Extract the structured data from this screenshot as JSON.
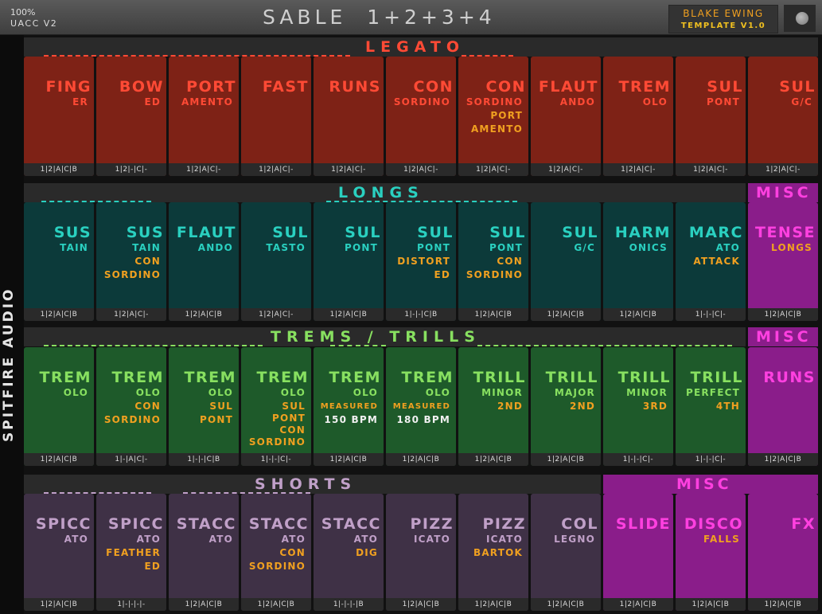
{
  "header": {
    "zoom": "100%",
    "version": "UACC V2",
    "title": "SABLE  1+2+3+4",
    "author": "BLAKE EWING",
    "template": "TEMPLATE V1.0"
  },
  "sidebar": {
    "label": "SPITFIRE AUDIO"
  },
  "colors": {
    "legato_tile": "#7e2216",
    "legato_text": "#ff4a35",
    "longs_tile": "#0c3a3a",
    "longs_text": "#2ad0c0",
    "trems_tile": "#1e5a2a",
    "trems_text": "#88e060",
    "shorts_tile": "#3f3146",
    "shorts_text": "#c0a0c8",
    "misc_tile": "#8a1d8a",
    "misc_text": "#ff40e0",
    "orange": "#f0a020"
  },
  "sections": {
    "legato": {
      "label": "LEGATO"
    },
    "longs": {
      "label": "LONGS",
      "misc": "MISC"
    },
    "trems": {
      "label": "TREMS / TRILLS",
      "misc": "MISC"
    },
    "shorts": {
      "label": "SHORTS",
      "misc": "MISC"
    }
  },
  "legato": [
    {
      "t1": "FING",
      "t2": "ER",
      "foot": "1|2|A|C|B"
    },
    {
      "t1": "BOW",
      "t2": "ED",
      "foot": "1|2|-|C|-"
    },
    {
      "t1": "PORT",
      "t2": "AMENTO",
      "foot": "1|2|A|C|-"
    },
    {
      "t1": "FAST",
      "t2": "",
      "foot": "1|2|A|C|-"
    },
    {
      "t1": "RUNS",
      "t2": "",
      "foot": "1|2|A|C|-"
    },
    {
      "t1": "CON",
      "t2": "SORDINO",
      "foot": "1|2|A|C|-"
    },
    {
      "t1": "CON",
      "t2": "SORDINO",
      "o1": "PORT",
      "o2": "AMENTO",
      "foot": "1|2|A|C|-"
    },
    {
      "t1": "FLAUT",
      "t2": "ANDO",
      "foot": "1|2|A|C|-"
    },
    {
      "t1": "TREM",
      "t2": "OLO",
      "foot": "1|2|A|C|-"
    },
    {
      "t1": "SUL",
      "t2": "PONT",
      "foot": "1|2|A|C|-"
    },
    {
      "t1": "SUL",
      "t2": "G/C",
      "foot": "1|2|A|C|-"
    }
  ],
  "longs": [
    {
      "t1": "SUS",
      "t2": "TAIN",
      "foot": "1|2|A|C|B"
    },
    {
      "t1": "SUS",
      "t2": "TAIN",
      "o1": "CON",
      "o2": "SORDINO",
      "foot": "1|2|A|C|-"
    },
    {
      "t1": "FLAUT",
      "t2": "ANDO",
      "foot": "1|2|A|C|B"
    },
    {
      "t1": "SUL",
      "t2": "TASTO",
      "foot": "1|2|A|C|-"
    },
    {
      "t1": "SUL",
      "t2": "PONT",
      "foot": "1|2|A|C|B"
    },
    {
      "t1": "SUL",
      "t2": "PONT",
      "o1": "DISTORT",
      "o2": "ED",
      "foot": "1|-|-|C|B"
    },
    {
      "t1": "SUL",
      "t2": "PONT",
      "o1": "CON",
      "o2": "SORDINO",
      "foot": "1|2|A|C|B"
    },
    {
      "t1": "SUL",
      "t2": "G/C",
      "foot": "1|2|A|C|B"
    },
    {
      "t1": "HARM",
      "t2": "ONICS",
      "foot": "1|2|A|C|B"
    },
    {
      "t1": "MARC",
      "t2": "ATO",
      "o1": "ATTACK",
      "foot": "1|-|-|C|-"
    },
    {
      "t1": "TENSE",
      "t2": "LONGS",
      "foot": "1|2|A|C|B"
    }
  ],
  "trems": [
    {
      "t1": "TREM",
      "t2": "OLO",
      "foot": "1|2|A|C|B"
    },
    {
      "t1": "TREM",
      "t2": "OLO",
      "o1": "CON",
      "o2": "SORDINO",
      "foot": "1|-|A|C|-"
    },
    {
      "t1": "TREM",
      "t2": "OLO",
      "o1": "SUL",
      "o2": "PONT",
      "foot": "1|-|-|C|B"
    },
    {
      "t1": "TREM",
      "t2": "OLO",
      "o1": "SUL",
      "o2": "PONT",
      "o3": "CON",
      "o4": "SORDINO",
      "foot": "1|-|-|C|-"
    },
    {
      "t1": "TREM",
      "t2": "OLO",
      "o1": "MEASURED",
      "o2": "150 BPM",
      "foot": "1|2|A|C|B"
    },
    {
      "t1": "TREM",
      "t2": "OLO",
      "o1": "MEASURED",
      "o2": "180 BPM",
      "foot": "1|2|A|C|B"
    },
    {
      "t1": "TRILL",
      "t2": "MINOR",
      "o1": "2ND",
      "foot": "1|2|A|C|B"
    },
    {
      "t1": "TRILL",
      "t2": "MAJOR",
      "o1": "2ND",
      "foot": "1|2|A|C|B"
    },
    {
      "t1": "TRILL",
      "t2": "MINOR",
      "o1": "3RD",
      "foot": "1|-|-|C|-"
    },
    {
      "t1": "TRILL",
      "t2": "PERFECT",
      "o1": "4TH",
      "foot": "1|-|-|C|-"
    },
    {
      "t1": "RUNS",
      "t2": "",
      "foot": "1|2|A|C|B"
    }
  ],
  "shorts": [
    {
      "t1": "SPICC",
      "t2": "ATO",
      "foot": "1|2|A|C|B"
    },
    {
      "t1": "SPICC",
      "t2": "ATO",
      "o1": "FEATHER",
      "o2": "ED",
      "foot": "1|-|-|-|-"
    },
    {
      "t1": "STACC",
      "t2": "ATO",
      "foot": "1|2|A|C|B"
    },
    {
      "t1": "STACC",
      "t2": "ATO",
      "o1": "CON",
      "o2": "SORDINO",
      "foot": "1|2|A|C|B"
    },
    {
      "t1": "STACC",
      "t2": "ATO",
      "o1": "DIG",
      "foot": "1|-|-|-|B"
    },
    {
      "t1": "PIZZ",
      "t2": "ICATO",
      "foot": "1|2|A|C|B"
    },
    {
      "t1": "PIZZ",
      "t2": "ICATO",
      "o1": "BARTOK",
      "foot": "1|2|A|C|B"
    },
    {
      "t1": "COL",
      "t2": "LEGNO",
      "foot": "1|2|A|C|B"
    },
    {
      "t1": "SLIDE",
      "t2": "",
      "foot": "1|2|A|C|B"
    },
    {
      "t1": "DISCO",
      "t2": "FALLS",
      "foot": "1|2|A|C|B"
    },
    {
      "t1": "FX",
      "t2": "",
      "foot": "1|2|A|C|B"
    }
  ]
}
